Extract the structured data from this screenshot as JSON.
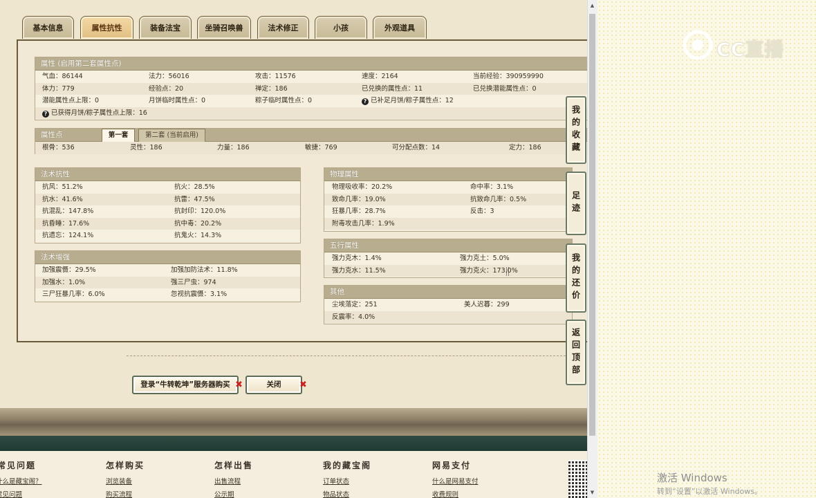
{
  "tabs": [
    {
      "label": "基本信息"
    },
    {
      "label": "属性抗性"
    },
    {
      "label": "装备法宝"
    },
    {
      "label": "坐骑召唤兽"
    },
    {
      "label": "法术修正"
    },
    {
      "label": "小孩"
    },
    {
      "label": "外观道具"
    }
  ],
  "attributes": {
    "title": "属性 (启用第二套属性点)",
    "rows": [
      [
        "气血：86144",
        "法力：56016",
        "攻击：11576",
        "速度：2164",
        "当前经验：390959990"
      ],
      [
        "体力：779",
        "经验点：20",
        "禅定：186",
        "已兑换的属性点：11",
        "已兑换潜能属性点：0"
      ],
      [
        "潜能属性点上限：0",
        "月饼临时属性点：0",
        "粽子临时属性点：0",
        "已补足月饼/粽子属性点：12"
      ],
      [
        "已获得月饼/粽子属性点上限：16"
      ]
    ]
  },
  "points": {
    "title": "属性点",
    "tab1": "第一套",
    "tab2": "第二套 (当前启用)",
    "values": [
      "根骨：536",
      "灵性：186",
      "力量：186",
      "敏捷：769",
      "可分配点数：14",
      "定力：186"
    ]
  },
  "resist": {
    "title": "法术抗性",
    "rows": [
      [
        "抗风：51.2%",
        "抗火：28.5%"
      ],
      [
        "抗水：41.6%",
        "抗雷：47.5%"
      ],
      [
        "抗混乱：147.8%",
        "抗封印：120.0%"
      ],
      [
        "抗昏睡：17.6%",
        "抗中毒：20.2%"
      ],
      [
        "抗遗忘：124.1%",
        "抗鬼火：14.3%"
      ]
    ]
  },
  "enhance": {
    "title": "法术增强",
    "rows": [
      [
        "加强震慑：29.5%",
        "加强加防法术：11.8%"
      ],
      [
        "加强水：1.0%",
        "强三尸虫：974"
      ],
      [
        "三尸狂暴几率：6.0%",
        "忽视抗震慑：3.1%"
      ]
    ]
  },
  "physical": {
    "title": "物理属性",
    "rows": [
      [
        "物理吸收率：20.2%",
        "命中率：3.1%"
      ],
      [
        "致命几率：19.0%",
        "抗致命几率：0.5%"
      ],
      [
        "狂暴几率：28.7%",
        "反击：3"
      ],
      [
        "附毒攻击几率：1.9%",
        ""
      ]
    ]
  },
  "wuxing": {
    "title": "五行属性",
    "rows": [
      [
        "强力克木：1.4%",
        "强力克土：5.0%"
      ],
      [
        "强力克水：11.5%",
        "强力克火：173.0%"
      ]
    ]
  },
  "other": {
    "title": "其他",
    "rows": [
      [
        "尘埃落定：251",
        "美人迟暮：299"
      ],
      [
        "反震率：4.0%",
        ""
      ]
    ]
  },
  "side_buttons": [
    "我的收藏",
    "足迹",
    "我的还价",
    "返回顶部"
  ],
  "actions": {
    "login_buy": "登录“牛转乾坤”服务器购买",
    "close": "关闭"
  },
  "footer": {
    "headings": [
      "常见问题",
      "怎样购买",
      "怎样出售",
      "我的藏宝阁",
      "网易支付"
    ],
    "links": [
      [
        "什么是藏宝阁？",
        "常见问题"
      ],
      [
        "浏览装备",
        "购买流程"
      ],
      [
        "出售流程",
        "公示期"
      ],
      [
        "订单状态",
        "物品状态"
      ],
      [
        "什么是网易支付",
        "收费规则"
      ]
    ]
  },
  "watermark": "CC直播",
  "windows": {
    "line1": "激活 Windows",
    "line2": "转到“设置”以激活 Windows。"
  },
  "colors": {
    "panel_bg": "#f1e9d5",
    "header_bar": "#b8ad8e",
    "active_tab": "#e2bf83",
    "close_x": "#c8231f",
    "footer_band": "#1f3a33"
  }
}
